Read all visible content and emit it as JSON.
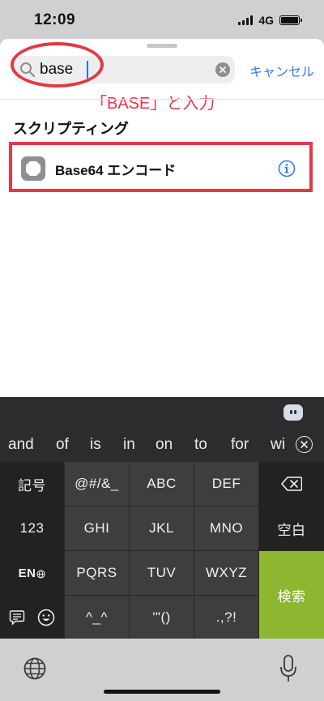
{
  "status": {
    "time": "12:09",
    "network": "4G"
  },
  "search": {
    "value": "base",
    "cancel_label": "キャンセル"
  },
  "annotation": {
    "text": "「BASE」と入力"
  },
  "section": {
    "title": "スクリプティング"
  },
  "result": {
    "label": "Base64 エンコード"
  },
  "suggestions": [
    "and",
    "of",
    "is",
    "in",
    "on",
    "to",
    "for",
    "wi"
  ],
  "keys": {
    "kigou": "記号",
    "k1": "@#/&_",
    "k2": "ABC",
    "k3": "DEF",
    "num": "123",
    "k4": "GHI",
    "k5": "JKL",
    "k6": "MNO",
    "space": "空白",
    "en": "EN",
    "k7": "PQRS",
    "k8": "TUV",
    "k9": "WXYZ",
    "search": "検索",
    "k_face": "^_^",
    "k0": "'\"()",
    "k_punct": ".,?!"
  },
  "colors": {
    "annotation": "#e03a45",
    "accent": "#3478f6",
    "search_key": "#8db631"
  }
}
